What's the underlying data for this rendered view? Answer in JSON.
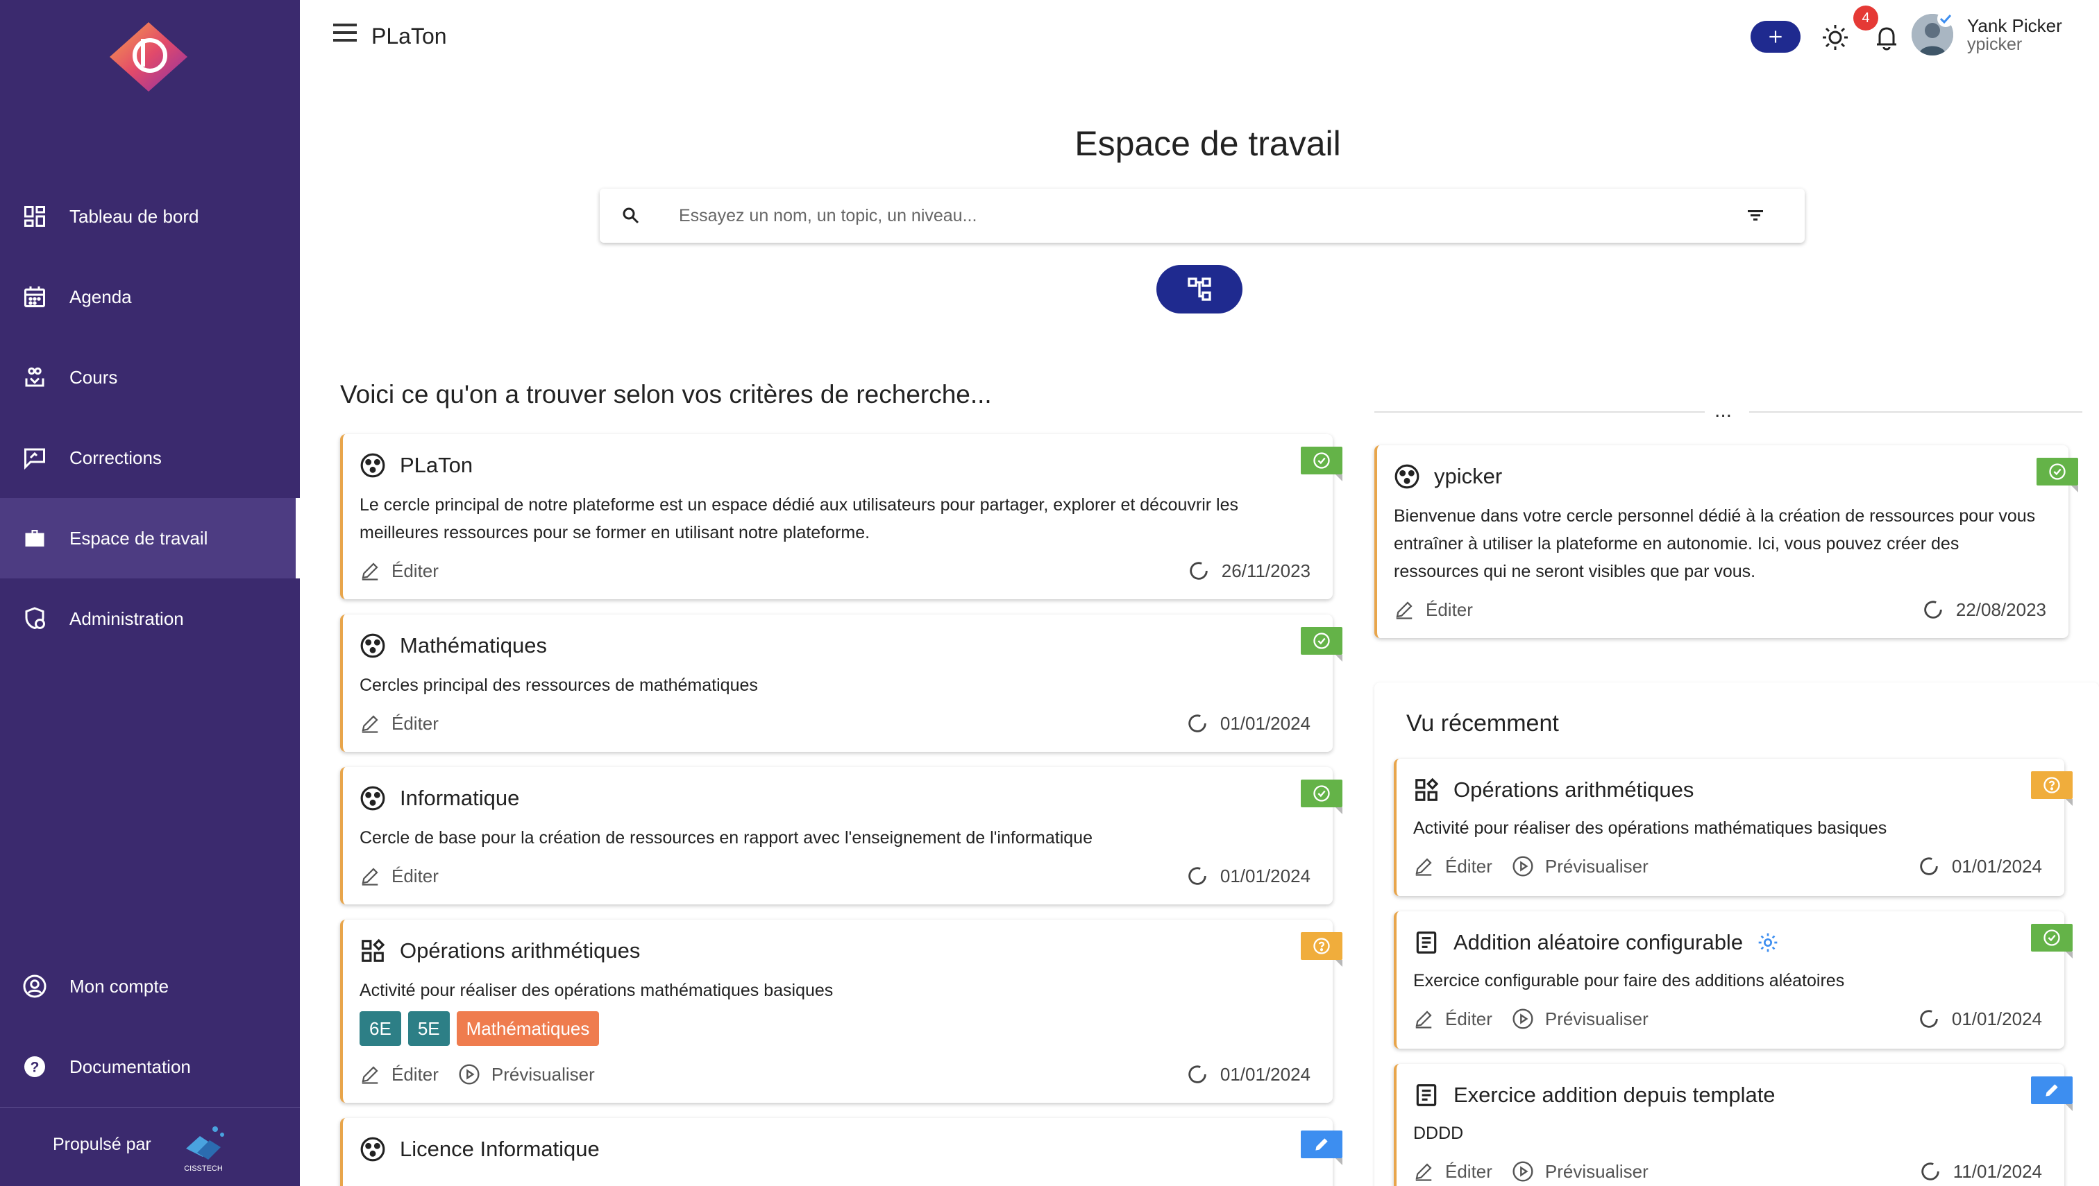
{
  "colors": {
    "sidebar_bg": "#3b2a6e",
    "primary": "#1f2a8f",
    "card_accent": "#e8a54b",
    "status_published": "#64b348",
    "status_review": "#f0ad3c",
    "status_draft": "#3d8ef0",
    "chip_level": "#2d7f86",
    "chip_topic": "#ef7c4e"
  },
  "sidebar": {
    "logo_icon": "platon-logo",
    "items": [
      {
        "label": "Tableau de bord",
        "icon": "dashboard-icon"
      },
      {
        "label": "Agenda",
        "icon": "calendar-icon"
      },
      {
        "label": "Cours",
        "icon": "course-icon"
      },
      {
        "label": "Corrections",
        "icon": "corrections-icon"
      },
      {
        "label": "Espace de travail",
        "icon": "briefcase-icon",
        "active": true
      },
      {
        "label": "Administration",
        "icon": "admin-icon"
      }
    ],
    "bottom_items": [
      {
        "label": "Mon compte",
        "icon": "account-icon"
      },
      {
        "label": "Documentation",
        "icon": "help-icon"
      }
    ],
    "powered_by": "Propulsé par",
    "powered_logo_text": "CISSTECH"
  },
  "header": {
    "title": "PLaTon",
    "notification_count": "4",
    "user": {
      "name": "Yank Picker",
      "handle": "ypicker"
    }
  },
  "main": {
    "page_title": "Espace de travail",
    "search": {
      "placeholder": "Essayez un nom, un topic, un niveau...",
      "value": ""
    },
    "results_heading": "Voici ce qu'on a trouver selon vos critères de recherche...",
    "results": [
      {
        "title": "PLaTon",
        "icon": "circle-icon",
        "description": "Le cercle principal de notre plateforme est un espace dédié aux utilisateurs pour partager, explorer et découvrir les meilleures ressources pour se former en utilisant notre plateforme.",
        "edit_label": "Éditer",
        "date": "26/11/2023",
        "status": "published"
      },
      {
        "title": "Mathématiques",
        "icon": "circle-icon",
        "description": "Cercles principal des ressources de mathématiques",
        "edit_label": "Éditer",
        "date": "01/01/2024",
        "status": "published"
      },
      {
        "title": "Informatique",
        "icon": "circle-icon",
        "description": "Cercle de base pour la création de ressources en rapport avec l'enseignement de l'informatique",
        "edit_label": "Éditer",
        "date": "01/01/2024",
        "status": "published"
      },
      {
        "title": "Opérations arithmétiques",
        "icon": "activity-icon",
        "description": "Activité pour réaliser des opérations mathématiques basiques",
        "chips": [
          "6E",
          "5E",
          "Mathématiques"
        ],
        "edit_label": "Éditer",
        "preview_label": "Prévisualiser",
        "date": "01/01/2024",
        "status": "review"
      },
      {
        "title": "Licence Informatique",
        "icon": "circle-icon",
        "status": "draft"
      }
    ]
  },
  "right": {
    "ellipsis": "...",
    "personal_circle": {
      "title": "ypicker",
      "icon": "circle-icon",
      "description": "Bienvenue dans votre cercle personnel dédié à la création de ressources pour vous entraîner à utiliser la plateforme en autonomie. Ici, vous pouvez créer des ressources qui ne seront visibles que par vous.",
      "edit_label": "Éditer",
      "date": "22/08/2023",
      "status": "published"
    },
    "recent": {
      "title": "Vu récemment",
      "items": [
        {
          "title": "Opérations arithmétiques",
          "icon": "activity-icon",
          "description": "Activité pour réaliser des opérations mathématiques basiques",
          "edit_label": "Éditer",
          "preview_label": "Prévisualiser",
          "date": "01/01/2024",
          "status": "review"
        },
        {
          "title": "Addition aléatoire configurable",
          "icon": "exercise-icon",
          "description": "Exercice configurable pour faire des additions aléatoires",
          "edit_label": "Éditer",
          "preview_label": "Prévisualiser",
          "date": "01/01/2024",
          "status": "published"
        },
        {
          "title": "Exercice addition depuis template",
          "icon": "exercise-icon",
          "description": "DDDD",
          "edit_label": "Éditer",
          "preview_label": "Prévisualiser",
          "date": "11/01/2024",
          "status": "draft"
        }
      ]
    }
  }
}
